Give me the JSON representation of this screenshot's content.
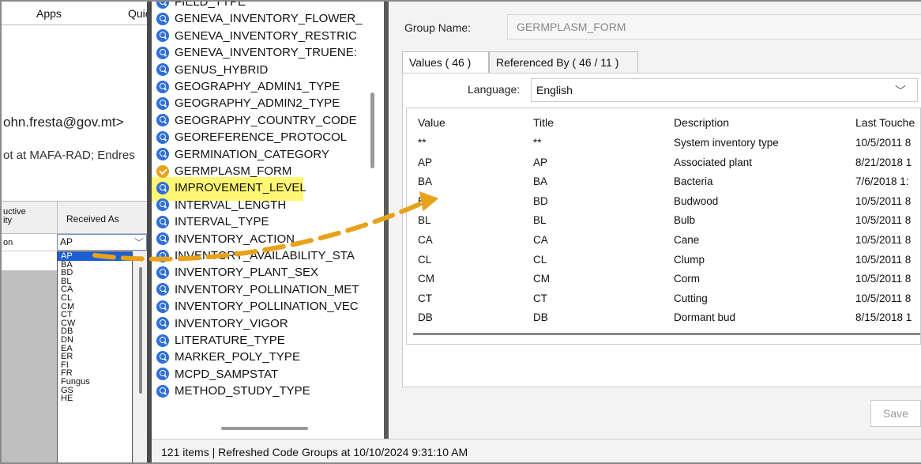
{
  "left": {
    "tabs": [
      "Apps",
      "Quic"
    ],
    "email_fragment": "ohn.fresta@gov.mt>",
    "cc_fragment": "ot at MAFA-RAD; Endres",
    "grid_header": {
      "col1": "uctive\nity",
      "col2": "Received As"
    },
    "row_value": "on",
    "combo_value": "AP",
    "dropdown_items": [
      "AP",
      "BA",
      "BD",
      "BL",
      "CA",
      "CL",
      "CM",
      "CT",
      "CW",
      "DB",
      "DN",
      "EA",
      "ER",
      "FI",
      "FR",
      "Fungus",
      "GS",
      "HE"
    ]
  },
  "groups": {
    "items": [
      "FIELD_TYPE",
      "GENEVA_INVENTORY_FLOWER_",
      "GENEVA_INVENTORY_RESTRIC",
      "GENEVA_INVENTORY_TRUENE:",
      "GENUS_HYBRID",
      "GEOGRAPHY_ADMIN1_TYPE",
      "GEOGRAPHY_ADMIN2_TYPE",
      "GEOGRAPHY_COUNTRY_CODE",
      "GEOREFERENCE_PROTOCOL",
      "GERMINATION_CATEGORY",
      "GERMPLASM_FORM",
      "IMPROVEMENT_LEVEL",
      "INTERVAL_LENGTH",
      "INTERVAL_TYPE",
      "INVENTORY_ACTION",
      "INVENTORY_AVAILABILITY_STA",
      "INVENTORY_PLANT_SEX",
      "INVENTORY_POLLINATION_MET",
      "INVENTORY_POLLINATION_VEC",
      "INVENTORY_VIGOR",
      "LITERATURE_TYPE",
      "MARKER_POLY_TYPE",
      "MCPD_SAMPSTAT",
      "METHOD_STUDY_TYPE"
    ],
    "selected_index": 10
  },
  "detail": {
    "group_name_label": "Group Name:",
    "group_name_value": "GERMPLASM_FORM",
    "tab_values": "Values ( 46 )",
    "tab_referenced": "Referenced By ( 46 / 11 )",
    "language_label": "Language:",
    "language_value": "English",
    "columns": [
      "Value",
      "Title",
      "Description",
      "Last Touche"
    ],
    "rows": [
      [
        "**",
        "**",
        "System inventory type",
        "10/5/2011 8"
      ],
      [
        "AP",
        "AP",
        "Associated plant",
        "8/21/2018 1"
      ],
      [
        "BA",
        "BA",
        "Bacteria",
        "7/6/2018 1:"
      ],
      [
        "BD",
        "BD",
        "Budwood",
        "10/5/2011 8"
      ],
      [
        "BL",
        "BL",
        "Bulb",
        "10/5/2011 8"
      ],
      [
        "CA",
        "CA",
        "Cane",
        "10/5/2011 8"
      ],
      [
        "CL",
        "CL",
        "Clump",
        "10/5/2011 8"
      ],
      [
        "CM",
        "CM",
        "Corm",
        "10/5/2011 8"
      ],
      [
        "CT",
        "CT",
        "Cutting",
        "10/5/2011 8"
      ],
      [
        "DB",
        "DB",
        "Dormant bud",
        "8/15/2018 1"
      ]
    ],
    "save_label": "Save"
  },
  "status": "121 items  |  Refreshed Code Groups at 10/10/2024 9:31:10 AM",
  "colors": {
    "highlight": "#fff65a",
    "arrow": "#e8a21a",
    "selection": "#1c5fd4",
    "icon": "#2f6fd6"
  }
}
